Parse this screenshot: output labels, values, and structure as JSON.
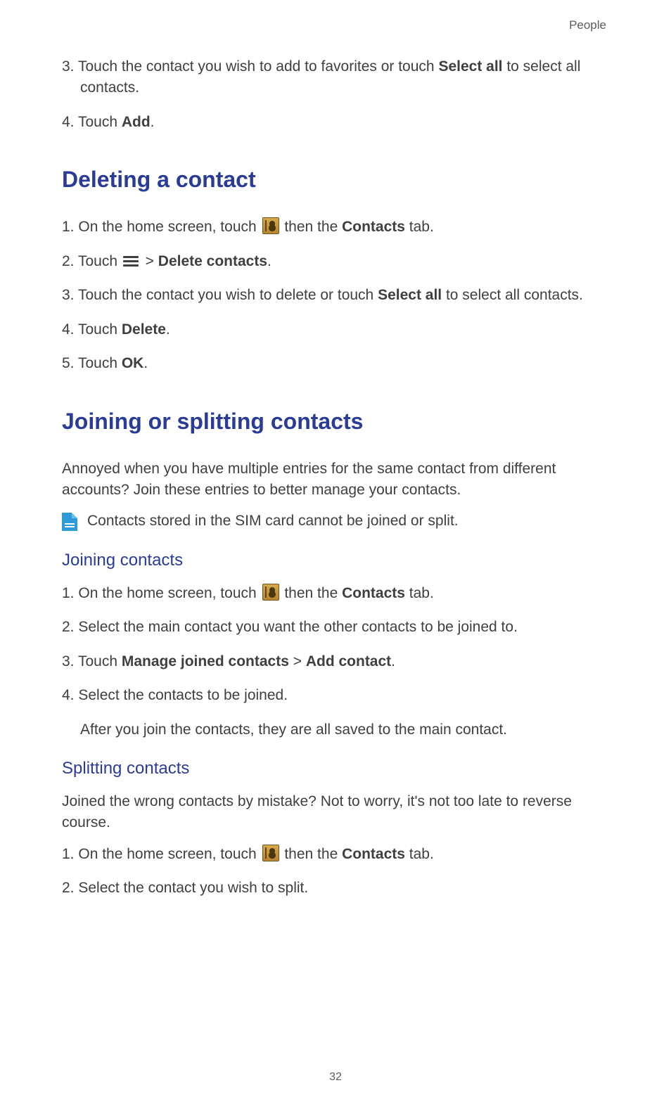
{
  "header": {
    "chapter": "People"
  },
  "footer": {
    "page_number": "32"
  },
  "intro_steps": {
    "s3": {
      "num": "3. ",
      "pre": "Touch the contact you wish to add to favorites or touch ",
      "bold": "Select all",
      "post": " to select all contacts."
    },
    "s4": {
      "num": "4. ",
      "pre": "Touch ",
      "bold": "Add",
      "post": "."
    }
  },
  "deleting": {
    "title": "Deleting a contact",
    "s1": {
      "num": "1. ",
      "pre": "On the home screen, touch ",
      "mid": " then the ",
      "bold": "Contacts",
      "post": " tab."
    },
    "s2": {
      "num": "2. ",
      "pre": "Touch ",
      "mid": " > ",
      "bold": "Delete contacts",
      "post": "."
    },
    "s3": {
      "num": "3. ",
      "pre": "Touch the contact you wish to delete or touch ",
      "bold": "Select all",
      "post": " to select all contacts."
    },
    "s4": {
      "num": "4. ",
      "pre": "Touch ",
      "bold": "Delete",
      "post": "."
    },
    "s5": {
      "num": "5. ",
      "pre": "Touch ",
      "bold": "OK",
      "post": "."
    }
  },
  "joining": {
    "title": "Joining or splitting contacts",
    "intro": "Annoyed when you have multiple entries for the same contact from different accounts? Join these entries to better manage your contacts.",
    "note": "Contacts stored in the SIM card cannot be joined or split.",
    "sub1": "Joining contacts",
    "j1": {
      "num": "1. ",
      "pre": "On the home screen, touch ",
      "mid": " then the ",
      "bold": "Contacts",
      "post": " tab."
    },
    "j2": {
      "num": "2. ",
      "text": "Select the main contact you want the other contacts to be joined to."
    },
    "j3": {
      "num": "3. ",
      "pre": "Touch ",
      "bold1": "Manage joined contacts",
      "mid": " > ",
      "bold2": "Add contact",
      "post": "."
    },
    "j4": {
      "num": "4. ",
      "text": "Select the contacts to be joined."
    },
    "j4_after": "After you join the contacts, they are all saved to the main contact.",
    "sub2": "Splitting contacts",
    "split_intro": "Joined the wrong contacts by mistake? Not to worry, it's not too late to reverse course.",
    "sp1": {
      "num": "1. ",
      "pre": "On the home screen, touch ",
      "mid": " then the ",
      "bold": "Contacts",
      "post": " tab."
    },
    "sp2": {
      "num": "2. ",
      "text": "Select the contact you wish to split."
    }
  }
}
